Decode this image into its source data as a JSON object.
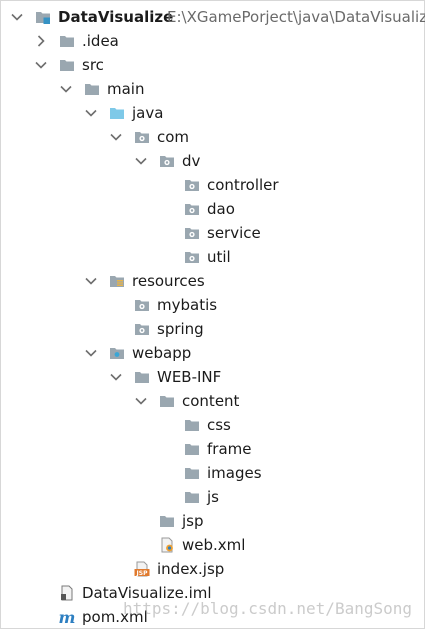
{
  "project": {
    "name": "DataVisualize",
    "path": "E:\\XGamePorject\\java\\DataVisualize"
  },
  "tree": {
    "idea": ".idea",
    "src": "src",
    "main": "main",
    "java": "java",
    "com": "com",
    "dv": "dv",
    "controller": "controller",
    "dao": "dao",
    "service": "service",
    "util": "util",
    "resources": "resources",
    "mybatis": "mybatis",
    "spring": "spring",
    "webapp": "webapp",
    "webinf": "WEB-INF",
    "content": "content",
    "css": "css",
    "frame": "frame",
    "images": "images",
    "js": "js",
    "jsp": "jsp",
    "webxml": "web.xml",
    "indexjsp": "index.jsp",
    "iml": "DataVisualize.iml",
    "pom": "pom.xml"
  },
  "watermark": "https://blog.csdn.net/BangSong",
  "colors": {
    "folder": "#9aa7b0",
    "source_folder": "#7ec9e8",
    "module_blue": "#3592c4",
    "jsp_orange": "#e07a2e",
    "maven_blue": "#2d7fc1"
  }
}
